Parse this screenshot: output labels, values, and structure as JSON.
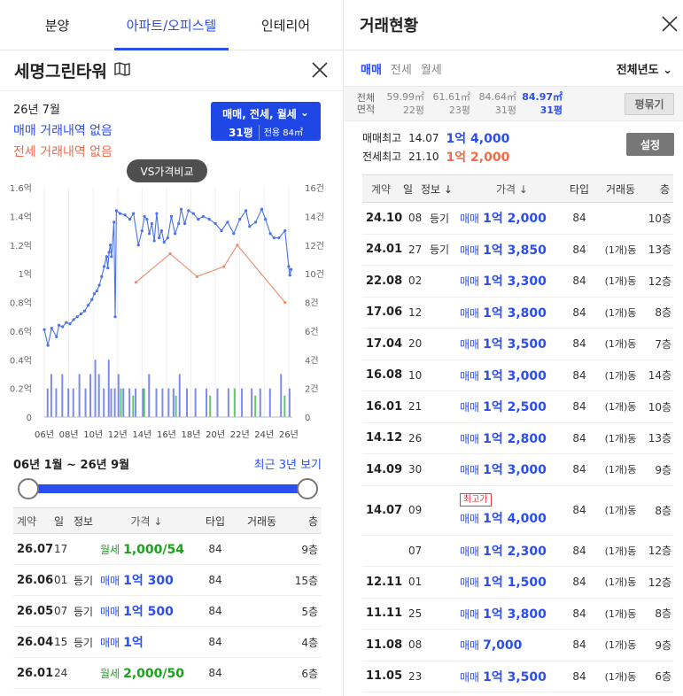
{
  "left": {
    "tabs": [
      "분양",
      "아파트/오피스텔",
      "인테리어"
    ],
    "title": "세명그린타워",
    "month": "26년 7월",
    "no_sale": "매매 거래내역 없음",
    "no_jeonse": "전세 거래내역 없음",
    "filter": {
      "types": "매매, 전세, 월세",
      "pyeong": "31평",
      "area": "전용 84㎡"
    },
    "vs_button": "VS가격비교",
    "range_label": "06년 1월 ~ 26년 9월",
    "recent_link": "최근 3년 보기",
    "table": {
      "headers": [
        "계약",
        "일",
        "정보",
        "가격 ↓",
        "타입",
        "거래동",
        "층"
      ],
      "rows": [
        {
          "ym": "26.07",
          "d": "17",
          "info": "",
          "kind": "월세",
          "price": "1,000/54",
          "type": "84",
          "dong": "",
          "floor": "9층"
        },
        {
          "ym": "26.06",
          "d": "01",
          "info": "등기",
          "kind": "매매",
          "price": "1억 300",
          "type": "84",
          "dong": "",
          "floor": "15층"
        },
        {
          "ym": "26.05",
          "d": "07",
          "info": "등기",
          "kind": "매매",
          "price": "1억 500",
          "type": "84",
          "dong": "",
          "floor": "5층"
        },
        {
          "ym": "26.04",
          "d": "15",
          "info": "등기",
          "kind": "매매",
          "price": "1억",
          "type": "84",
          "dong": "",
          "floor": "4층"
        },
        {
          "ym": "26.01",
          "d": "24",
          "info": "",
          "kind": "월세",
          "price": "2,000/50",
          "type": "84",
          "dong": "",
          "floor": "6층"
        }
      ]
    }
  },
  "right": {
    "title": "거래현황",
    "tabs": [
      "매매",
      "전세",
      "월세"
    ],
    "year_select": "전체년도",
    "area_header": [
      "전체",
      "면적"
    ],
    "areas": [
      {
        "m2": "59.99㎡",
        "py": "22평"
      },
      {
        "m2": "61.61㎡",
        "py": "23평"
      },
      {
        "m2": "84.64㎡",
        "py": "31평"
      },
      {
        "m2": "84.97㎡",
        "py": "31평"
      }
    ],
    "pyeong_button": "평묶기",
    "max_sale": {
      "label": "매매최고",
      "ym": "14.07",
      "value": "1억 4,000"
    },
    "max_jeonse": {
      "label": "전세최고",
      "ym": "21.10",
      "value": "1억 2,000"
    },
    "settings_button": "설정",
    "table": {
      "headers": [
        "계약",
        "일",
        "정보 ↓",
        "가격 ↓",
        "타입",
        "거래동",
        "층"
      ],
      "rows": [
        {
          "ym": "24.10",
          "d": "08",
          "info": "등기",
          "kind": "매매",
          "price": "1억 2,000",
          "type": "84",
          "dong": "",
          "floor": "10층",
          "badge": ""
        },
        {
          "ym": "24.01",
          "d": "27",
          "info": "등기",
          "kind": "매매",
          "price": "1억 3,850",
          "type": "84",
          "dong": "(1개)동",
          "floor": "13층",
          "badge": ""
        },
        {
          "ym": "22.08",
          "d": "02",
          "info": "",
          "kind": "매매",
          "price": "1억 3,300",
          "type": "84",
          "dong": "(1개)동",
          "floor": "12층",
          "badge": ""
        },
        {
          "ym": "17.06",
          "d": "12",
          "info": "",
          "kind": "매매",
          "price": "1억 3,800",
          "type": "84",
          "dong": "(1개)동",
          "floor": "8층",
          "badge": ""
        },
        {
          "ym": "17.04",
          "d": "20",
          "info": "",
          "kind": "매매",
          "price": "1억 3,500",
          "type": "84",
          "dong": "(1개)동",
          "floor": "7층",
          "badge": ""
        },
        {
          "ym": "16.08",
          "d": "10",
          "info": "",
          "kind": "매매",
          "price": "1억 3,000",
          "type": "84",
          "dong": "(1개)동",
          "floor": "14층",
          "badge": ""
        },
        {
          "ym": "16.01",
          "d": "21",
          "info": "",
          "kind": "매매",
          "price": "1억 2,500",
          "type": "84",
          "dong": "(1개)동",
          "floor": "10층",
          "badge": ""
        },
        {
          "ym": "14.12",
          "d": "26",
          "info": "",
          "kind": "매매",
          "price": "1억 2,800",
          "type": "84",
          "dong": "(1개)동",
          "floor": "13층",
          "badge": ""
        },
        {
          "ym": "14.09",
          "d": "30",
          "info": "",
          "kind": "매매",
          "price": "1억 3,000",
          "type": "84",
          "dong": "(1개)동",
          "floor": "9층",
          "badge": ""
        },
        {
          "ym": "14.07",
          "d": "09",
          "info": "",
          "kind": "매매",
          "price": "1억 4,000",
          "type": "84",
          "dong": "(1개)동",
          "floor": "8층",
          "badge": "최고가"
        },
        {
          "ym": "",
          "d": "07",
          "info": "",
          "kind": "매매",
          "price": "1억 2,300",
          "type": "84",
          "dong": "(1개)동",
          "floor": "12층",
          "badge": ""
        },
        {
          "ym": "12.11",
          "d": "01",
          "info": "",
          "kind": "매매",
          "price": "1억 1,500",
          "type": "84",
          "dong": "(1개)동",
          "floor": "12층",
          "badge": ""
        },
        {
          "ym": "11.11",
          "d": "25",
          "info": "",
          "kind": "매매",
          "price": "1억 3,800",
          "type": "84",
          "dong": "(1개)동",
          "floor": "8층",
          "badge": ""
        },
        {
          "ym": "11.08",
          "d": "08",
          "info": "",
          "kind": "매매",
          "price": "7,000",
          "type": "84",
          "dong": "(1개)동",
          "floor": "9층",
          "badge": ""
        },
        {
          "ym": "11.05",
          "d": "23",
          "info": "",
          "kind": "매매",
          "price": "1억 3,500",
          "type": "84",
          "dong": "(1개)동",
          "floor": "6층",
          "badge": ""
        }
      ]
    }
  },
  "colors": {
    "accent": "#2b4ef0",
    "jeonse": "#ef6b4a",
    "rent": "#1aa31a"
  },
  "chart_data": {
    "type": "line",
    "x_ticks": [
      "06년",
      "08년",
      "10년",
      "12년",
      "14년",
      "16년",
      "18년",
      "20년",
      "22년",
      "24년",
      "26년"
    ],
    "y_left_ticks": [
      "0",
      "0.2억",
      "0.4억",
      "0.6억",
      "0.8억",
      "1억",
      "1.2억",
      "1.4억",
      "1.6억"
    ],
    "y_right_ticks": [
      "0",
      "2건",
      "4건",
      "6건",
      "8건",
      "10건",
      "12건",
      "14건",
      "16건"
    ],
    "ylim_left": [
      0,
      1.6
    ],
    "ylim_right": [
      0,
      16
    ],
    "series": [
      {
        "color": "#4a73e8",
        "points": [
          [
            2006.0,
            0.61
          ],
          [
            2006.3,
            0.5
          ],
          [
            2006.6,
            0.62
          ],
          [
            2007.0,
            0.56
          ],
          [
            2007.2,
            0.64
          ],
          [
            2007.5,
            0.63
          ],
          [
            2007.8,
            0.66
          ],
          [
            2008.1,
            0.65
          ],
          [
            2008.4,
            0.68
          ],
          [
            2008.7,
            0.7
          ],
          [
            2009.0,
            0.72
          ],
          [
            2009.3,
            0.74
          ],
          [
            2009.6,
            0.78
          ],
          [
            2009.9,
            0.82
          ],
          [
            2010.1,
            0.86
          ],
          [
            2010.3,
            0.88
          ],
          [
            2010.5,
            0.92
          ],
          [
            2010.7,
            0.98
          ],
          [
            2010.9,
            1.05
          ],
          [
            2011.1,
            1.12
          ],
          [
            2011.2,
            1.04
          ],
          [
            2011.3,
            1.15
          ],
          [
            2011.4,
            1.2
          ],
          [
            2011.5,
            1.12
          ],
          [
            2011.7,
            1.36
          ],
          [
            2011.8,
            0.7
          ],
          [
            2011.9,
            1.44
          ],
          [
            2012.2,
            1.42
          ],
          [
            2012.6,
            1.41
          ],
          [
            2013.0,
            1.38
          ],
          [
            2013.3,
            1.42
          ],
          [
            2013.7,
            1.2
          ],
          [
            2014.0,
            1.3
          ],
          [
            2014.2,
            1.4
          ],
          [
            2014.4,
            1.38
          ],
          [
            2014.6,
            1.28
          ],
          [
            2014.8,
            1.35
          ],
          [
            2015.0,
            1.23
          ],
          [
            2015.2,
            1.42
          ],
          [
            2015.4,
            1.25
          ],
          [
            2015.6,
            1.3
          ],
          [
            2015.8,
            1.22
          ],
          [
            2016.1,
            1.25
          ],
          [
            2016.4,
            1.4
          ],
          [
            2016.7,
            1.28
          ],
          [
            2017.0,
            1.35
          ],
          [
            2017.2,
            1.45
          ],
          [
            2017.5,
            1.35
          ],
          [
            2017.8,
            1.44
          ],
          [
            2018.2,
            1.42
          ],
          [
            2018.6,
            1.38
          ],
          [
            2019.0,
            1.4
          ],
          [
            2019.5,
            1.38
          ],
          [
            2020.0,
            1.35
          ],
          [
            2020.5,
            1.3
          ],
          [
            2021.0,
            1.36
          ],
          [
            2021.5,
            1.28
          ],
          [
            2022.0,
            1.38
          ],
          [
            2022.5,
            1.44
          ],
          [
            2022.8,
            1.33
          ],
          [
            2023.3,
            1.36
          ],
          [
            2023.8,
            1.45
          ],
          [
            2024.1,
            1.38
          ],
          [
            2024.5,
            1.28
          ],
          [
            2024.8,
            1.25
          ],
          [
            2025.2,
            1.25
          ],
          [
            2025.7,
            1.3
          ],
          [
            2026.0,
            1.05
          ],
          [
            2026.1,
            0.99
          ],
          [
            2026.2,
            1.03
          ]
        ]
      },
      {
        "color": "#ef8a6a",
        "points": [
          [
            2013.5,
            0.94
          ],
          [
            2016.3,
            1.14
          ],
          [
            2018.5,
            0.98
          ],
          [
            2020.7,
            1.05
          ],
          [
            2021.8,
            1.2
          ],
          [
            2025.7,
            0.8
          ]
        ]
      }
    ],
    "volume_bars": "vertical blue/green count bars along the bottom"
  }
}
